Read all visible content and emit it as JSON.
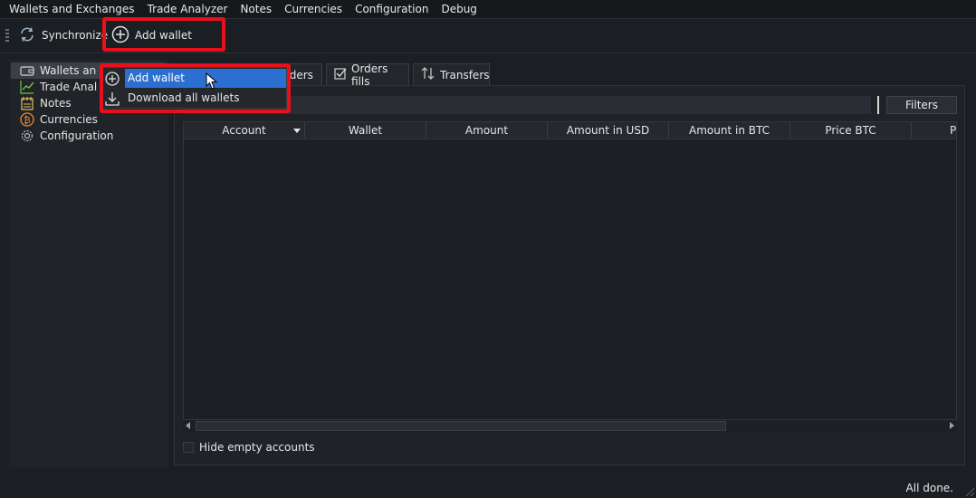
{
  "menubar": {
    "items": [
      "Wallets and Exchanges",
      "Trade Analyzer",
      "Notes",
      "Currencies",
      "Configuration",
      "Debug"
    ]
  },
  "toolbar": {
    "synchronize_label": "Synchronize",
    "add_wallet_label": "Add wallet"
  },
  "sidebar": {
    "items": [
      {
        "label": "Wallets an",
        "icon": "wallet-icon"
      },
      {
        "label": "Trade Anal",
        "icon": "chart-line-icon"
      },
      {
        "label": "Notes",
        "icon": "notes-icon"
      },
      {
        "label": "Currencies",
        "icon": "bitcoin-icon"
      },
      {
        "label": "Configuration",
        "icon": "gear-icon"
      }
    ]
  },
  "context_menu": {
    "items": [
      {
        "label": "Add wallet",
        "icon": "plus-circle-icon"
      },
      {
        "label": "Download all wallets",
        "icon": "download-icon"
      }
    ]
  },
  "tabs": [
    {
      "label": "rders",
      "icon": ""
    },
    {
      "label": "Orders fills",
      "icon": "checkbox-icon"
    },
    {
      "label": "Transfers",
      "icon": "transfer-arrows-icon"
    }
  ],
  "filter": {
    "button_label": "Filters"
  },
  "table": {
    "columns": [
      "Account",
      "Wallet",
      "Amount",
      "Amount in USD",
      "Amount in BTC",
      "Price BTC",
      "Pr"
    ]
  },
  "hide_empty_label": "Hide empty accounts",
  "status_text": "All done.",
  "colors": {
    "highlight": "#e8101a",
    "selection": "#2b6fd0",
    "background": "#1b1e23"
  }
}
